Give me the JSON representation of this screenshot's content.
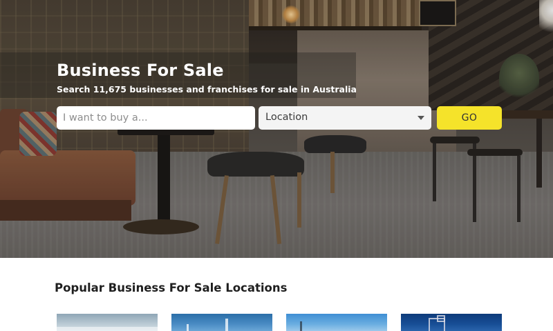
{
  "hero": {
    "title": "Business For Sale",
    "subtitle": "Search 11,675 businesses and franchises for sale in Australia"
  },
  "search": {
    "placeholder": "I want to buy a...",
    "location_label": "Location",
    "go_label": "GO"
  },
  "popular": {
    "title": "Popular Business For Sale Locations",
    "cards": [
      {
        "name": "location-card-1"
      },
      {
        "name": "location-card-2"
      },
      {
        "name": "location-card-3"
      },
      {
        "name": "location-card-4"
      }
    ]
  },
  "colors": {
    "go_button": "#f5e32a",
    "input_bg": "#ffffff",
    "select_bg": "#f4f4f4",
    "text_dark": "#1f1f1f"
  }
}
